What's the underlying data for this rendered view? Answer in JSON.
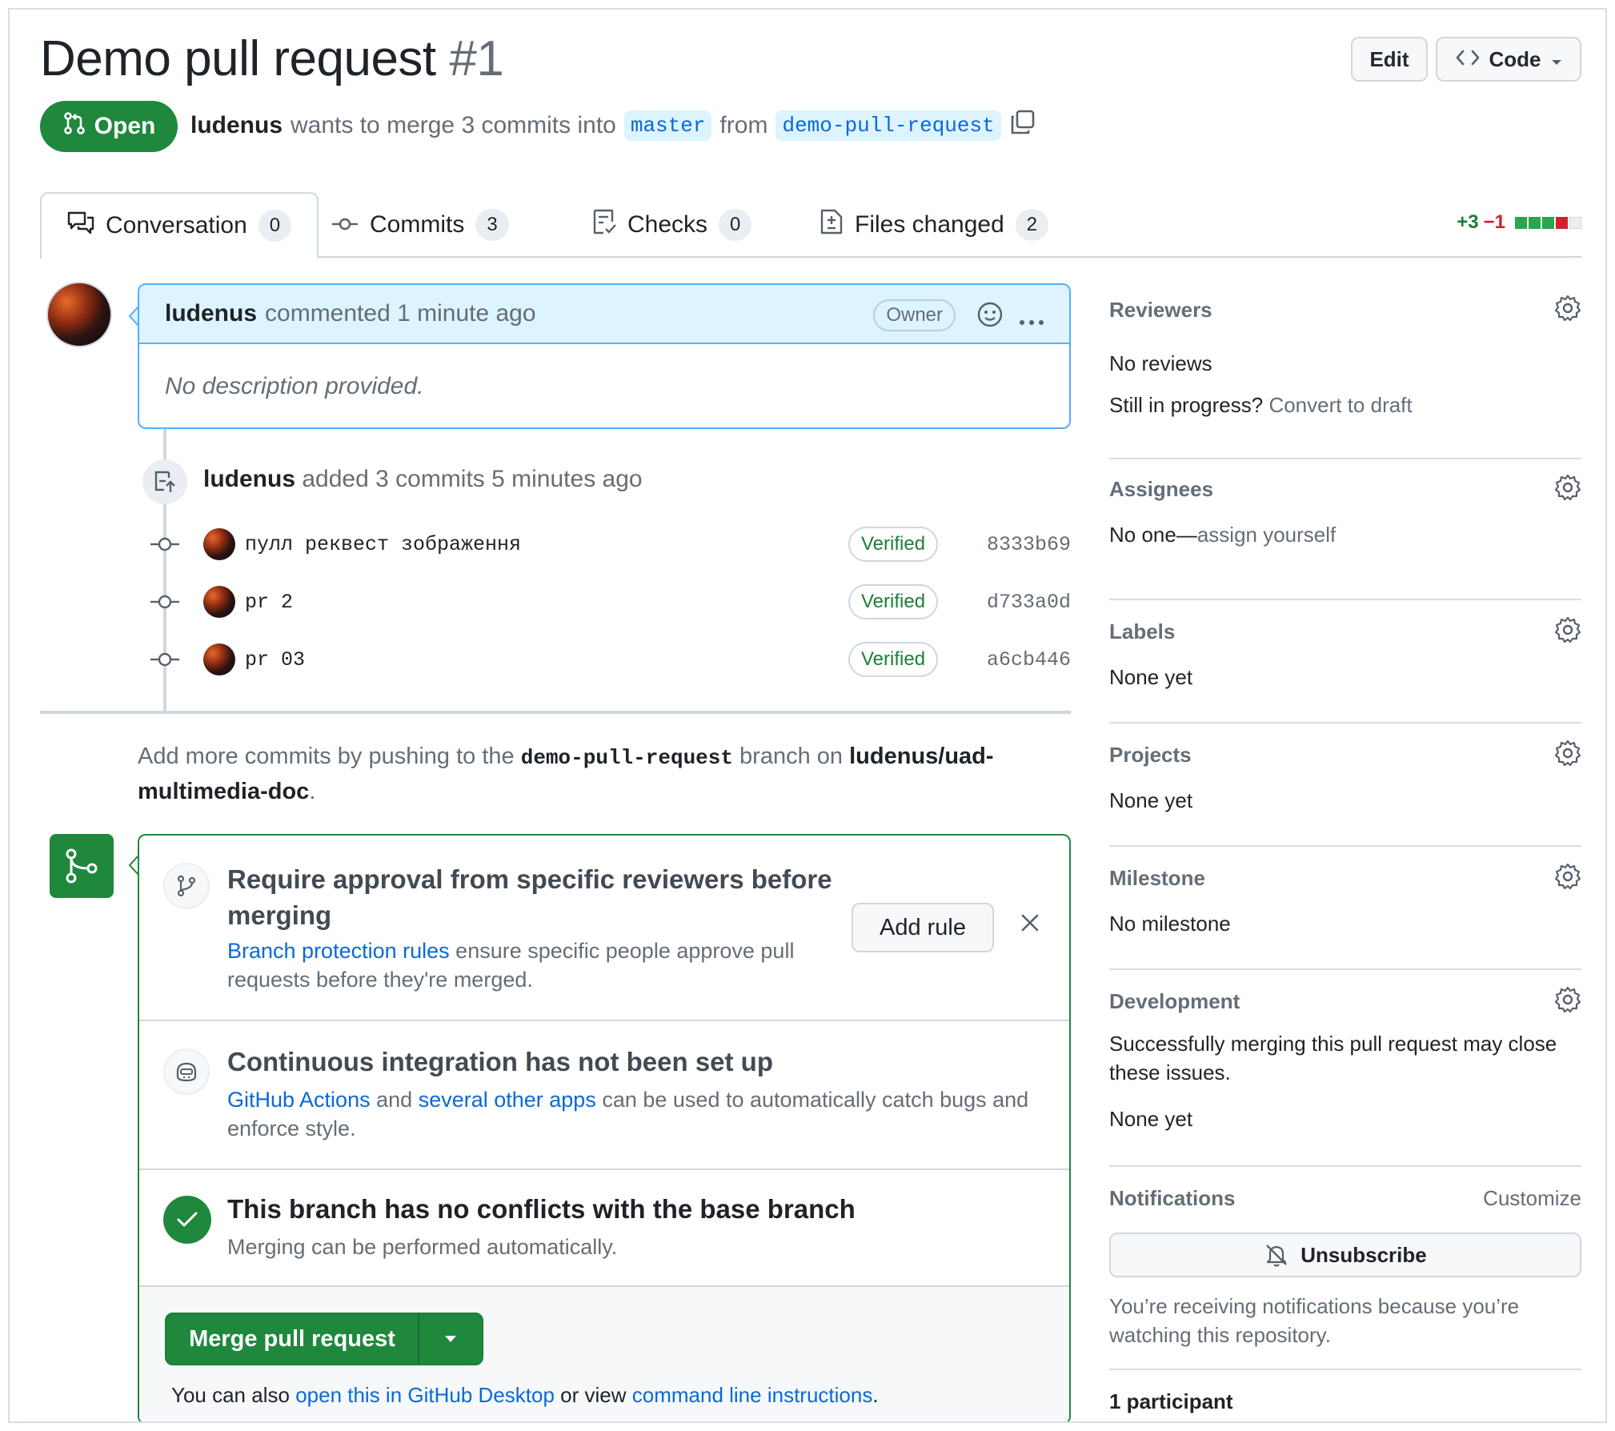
{
  "header": {
    "title": "Demo pull request",
    "number": "#1",
    "edit_label": "Edit",
    "code_label": "Code"
  },
  "status": {
    "state": "Open",
    "author": "ludenus",
    "merge_text": "wants to merge 3 commits into",
    "base_branch": "master",
    "from_text": "from",
    "head_branch": "demo-pull-request"
  },
  "tabs": [
    {
      "label": "Conversation",
      "count": "0"
    },
    {
      "label": "Commits",
      "count": "3"
    },
    {
      "label": "Checks",
      "count": "0"
    },
    {
      "label": "Files changed",
      "count": "2"
    }
  ],
  "diffstat": {
    "additions": "+3",
    "deletions": "−1"
  },
  "comment": {
    "author": "ludenus",
    "meta": "commented 1 minute ago",
    "badge": "Owner",
    "body": "No description provided."
  },
  "commits_event": {
    "author": "ludenus",
    "text": "added 3 commits 5 minutes ago"
  },
  "commits": [
    {
      "message": "пулл реквест зображення",
      "verified": "Verified",
      "sha": "8333b69"
    },
    {
      "message": "pr 2",
      "verified": "Verified",
      "sha": "d733a0d"
    },
    {
      "message": "pr 03",
      "verified": "Verified",
      "sha": "a6cb446"
    }
  ],
  "add_more": {
    "prefix": "Add more commits by pushing to the",
    "branch": "demo-pull-request",
    "middle": "branch on",
    "repo": "ludenus/uad-multimedia-doc",
    "suffix": "."
  },
  "merge_box": {
    "rule": {
      "title": "Require approval from specific reviewers before merging",
      "link": "Branch protection rules",
      "desc": "ensure specific people approve pull requests before they're merged.",
      "button": "Add rule"
    },
    "ci": {
      "title": "Continuous integration has not been set up",
      "link1": "GitHub Actions",
      "and": "and",
      "link2": "several other apps",
      "desc": "can be used to automatically catch bugs and enforce style."
    },
    "conflicts": {
      "title": "This branch has no conflicts with the base branch",
      "desc": "Merging can be performed automatically."
    },
    "merge_button": "Merge pull request",
    "footer": {
      "prefix": "You can also",
      "link1": "open this in GitHub Desktop",
      "middle": "or view",
      "link2": "command line instructions",
      "suffix": "."
    }
  },
  "sidebar": {
    "reviewers": {
      "title": "Reviewers",
      "value": "No reviews",
      "progress_q": "Still in progress?",
      "draft_link": "Convert to draft"
    },
    "assignees": {
      "title": "Assignees",
      "value": "No one—",
      "link": "assign yourself"
    },
    "labels": {
      "title": "Labels",
      "value": "None yet"
    },
    "projects": {
      "title": "Projects",
      "value": "None yet"
    },
    "milestone": {
      "title": "Milestone",
      "value": "No milestone"
    },
    "development": {
      "title": "Development",
      "desc": "Successfully merging this pull request may close these issues.",
      "value": "None yet"
    },
    "notifications": {
      "title": "Notifications",
      "customize": "Customize",
      "button": "Unsubscribe",
      "reason": "You’re receiving notifications because you’re watching this repository."
    },
    "participants": {
      "title": "1 participant"
    }
  },
  "colors": {
    "accent_green": "#1f883d",
    "link_blue": "#0969da",
    "muted": "#656d76"
  }
}
